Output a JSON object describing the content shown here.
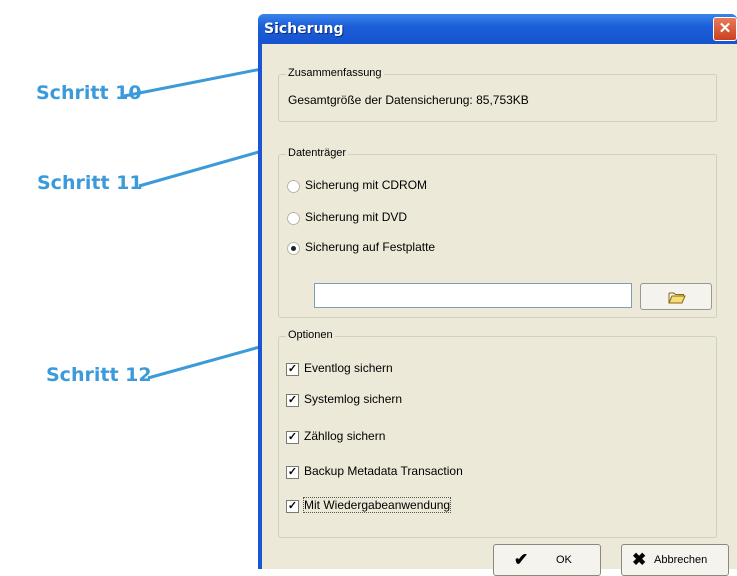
{
  "callouts": [
    "Schritt 10",
    "Schritt 11",
    "Schritt 12"
  ],
  "window": {
    "title": "Sicherung",
    "close_glyph": "✕"
  },
  "summary": {
    "legend": "Zusammenfassung",
    "text": "Gesamtgröße der Datensicherung: 85,753KB"
  },
  "media": {
    "legend": "Datenträger",
    "options": [
      "Sicherung mit CDROM",
      "Sicherung mit DVD",
      "Sicherung auf Festplatte"
    ],
    "selected_index": 2,
    "path_value": "",
    "browse_icon": "folder-open-icon"
  },
  "options": {
    "legend": "Optionen",
    "items": [
      {
        "label": "Eventlog sichern",
        "checked": true
      },
      {
        "label": "Systemlog sichern",
        "checked": true
      },
      {
        "label": "Zähllog sichern",
        "checked": true
      },
      {
        "label": "Backup Metadata Transaction",
        "checked": true
      },
      {
        "label": "Mit Wiedergabeanwendung",
        "checked": true
      }
    ]
  },
  "buttons": {
    "ok_label": "OK",
    "cancel_label": "Abbrechen"
  },
  "colors": {
    "callout": "#3b9ad9",
    "titlebar": "#1c5fd8",
    "dialog_bg": "#ece9d8"
  }
}
